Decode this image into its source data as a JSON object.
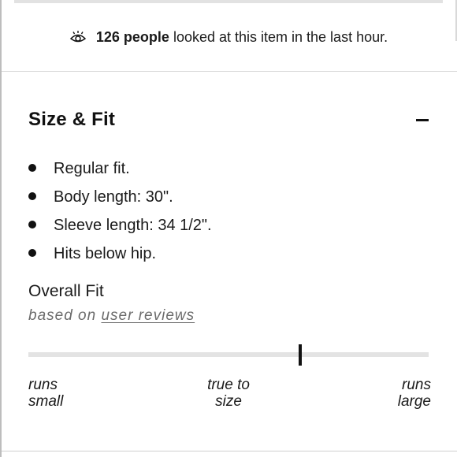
{
  "views": {
    "icon": "eye-icon",
    "count_text": "126 people",
    "rest_text": "looked at this item in the last hour."
  },
  "section": {
    "title": "Size & Fit",
    "toggle_icon": "minus-icon",
    "bullets": [
      "Regular fit.",
      "Body length: 30\".",
      "Sleeve length: 34 1/2\".",
      "Hits below hip."
    ]
  },
  "overall_fit": {
    "title": "Overall Fit",
    "subtitle_prefix": "based on",
    "reviews_link": "user reviews",
    "marker_position": 0.68,
    "scale": {
      "left": [
        "runs",
        "small"
      ],
      "middle": [
        "true to",
        "size"
      ],
      "right": [
        "runs",
        "large"
      ]
    }
  }
}
